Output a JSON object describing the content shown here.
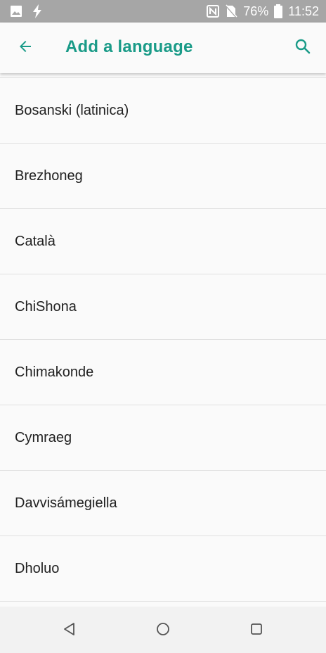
{
  "status_bar": {
    "battery": "76%",
    "time": "11:52",
    "icons": [
      "image-icon",
      "flash-icon",
      "nfc-icon",
      "no-sim-icon",
      "battery-icon"
    ]
  },
  "toolbar": {
    "title": "Add a language",
    "accent_color": "#1a9b88",
    "back_icon": "arrow-back-icon",
    "search_icon": "search-icon"
  },
  "languages": [
    "Bosanski (latinica)",
    "Brezhoneg",
    "Català",
    "ChiShona",
    "Chimakonde",
    "Cymraeg",
    "Davvisámegiella",
    "Dholuo"
  ],
  "nav_bar": {
    "icons": [
      "back-triangle-icon",
      "home-circle-icon",
      "recents-square-icon"
    ]
  }
}
